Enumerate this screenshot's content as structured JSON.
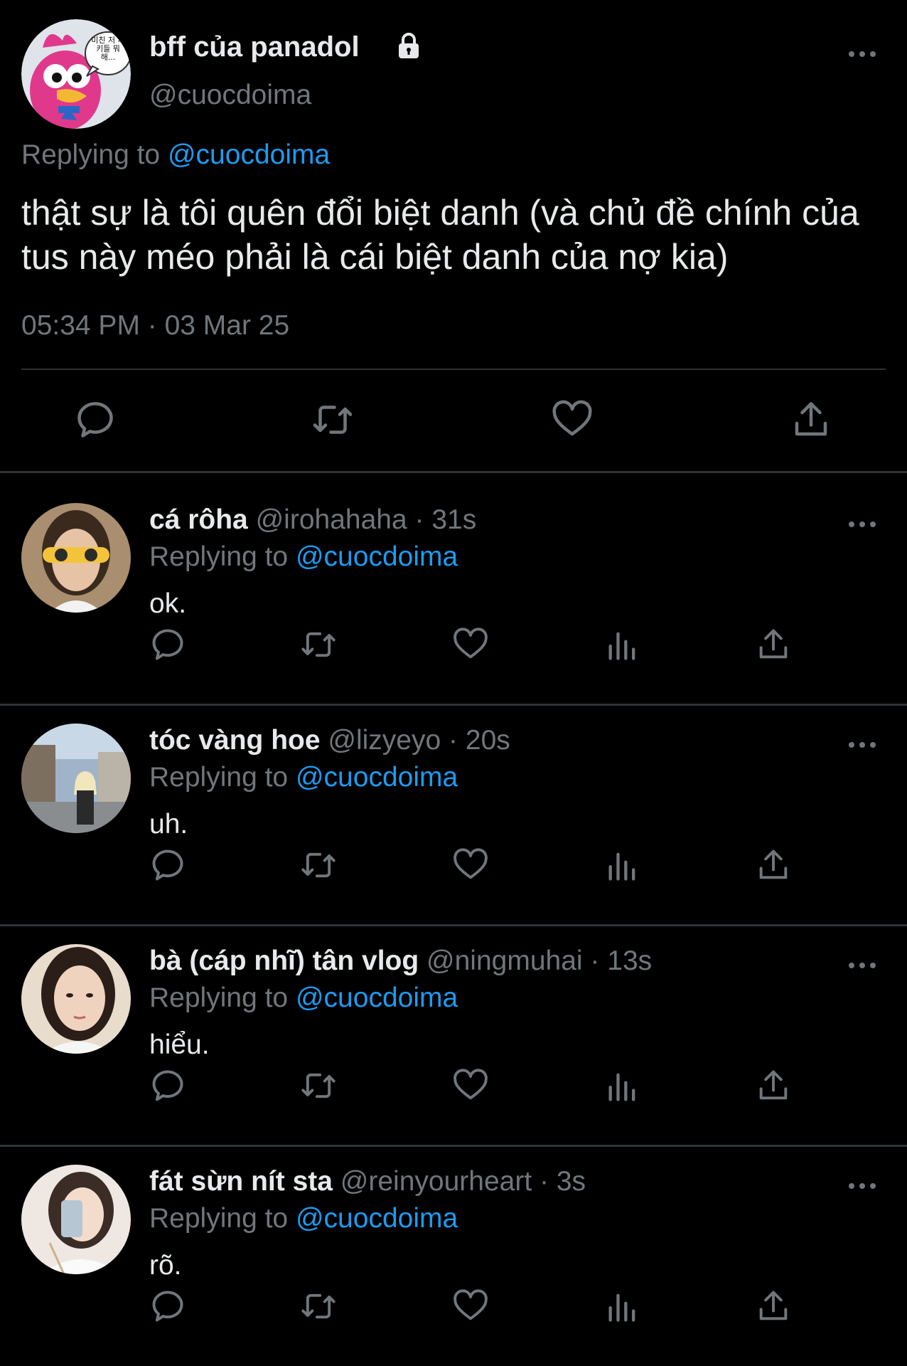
{
  "main_tweet": {
    "display_name": "bff của panadol",
    "handle": "@cuocdoima",
    "replying_prefix": "Replying to",
    "replying_to": "@cuocdoima",
    "text": "thật sự là tôi quên đổi biệt danh (và chủ đề chính của tus này méo phải là cái biệt danh của nợ kia)",
    "timestamp": "05:34 PM · 03 Mar 25",
    "avatar_speech_bubble_text": "미친 저 새키들 뭐해...",
    "actions": [
      "reply-icon",
      "retweet-icon",
      "like-icon",
      "share-icon"
    ]
  },
  "replies": [
    {
      "display_name": "cá rôha",
      "handle": "@irohahaha",
      "separator": "·",
      "time": "31s",
      "replying_prefix": "Replying to",
      "replying_to": "@cuocdoima",
      "text": "ok."
    },
    {
      "display_name": "tóc vàng hoe",
      "handle": "@lizyeyo",
      "separator": "·",
      "time": "20s",
      "replying_prefix": "Replying to",
      "replying_to": "@cuocdoima",
      "text": "uh."
    },
    {
      "display_name": "bà (cáp nhĩ) tân vlog",
      "handle": "@ningmuhai",
      "separator": "·",
      "time": "13s",
      "replying_prefix": "Replying to",
      "replying_to": "@cuocdoima",
      "text": "hiểu."
    },
    {
      "display_name": "fát sừn nít sta",
      "handle": "@reinyourheart",
      "separator": "·",
      "time": "3s",
      "replying_prefix": "Replying to",
      "replying_to": "@cuocdoima",
      "text": "rõ."
    }
  ],
  "reply_actions": [
    "reply-icon",
    "retweet-icon",
    "like-icon",
    "views-icon",
    "share-icon"
  ],
  "colors": {
    "background": "#000000",
    "text_primary": "#e7e9ea",
    "text_secondary": "#71767b",
    "link": "#1d9bf0",
    "divider": "#2f3336"
  }
}
